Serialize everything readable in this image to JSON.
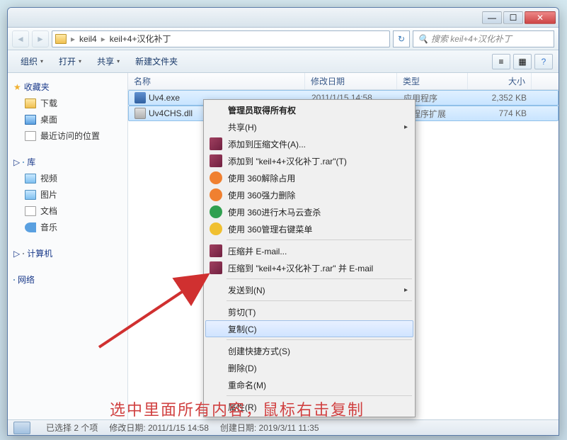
{
  "titlebar": {
    "min": "—",
    "max": "☐",
    "close": "✕"
  },
  "nav": {
    "back": "◄",
    "fwd": "►"
  },
  "breadcrumb": {
    "seg1": "keil4",
    "seg2": "keil+4+汉化补丁",
    "sep": "▸"
  },
  "refresh": "↻",
  "search": {
    "placeholder": "搜索 keil+4+汉化补丁",
    "icon": "🔍"
  },
  "toolbar": {
    "org": "组织",
    "open": "打开",
    "share": "共享",
    "new": "新建文件夹",
    "dd": "▾",
    "view1": "≡",
    "view2": "▦",
    "help": "?"
  },
  "columns": {
    "name": "名称",
    "date": "修改日期",
    "type": "类型",
    "size": "大小"
  },
  "sidebar": {
    "fav": {
      "hdr": "收藏夹",
      "star": "★",
      "items": [
        "下载",
        "桌面",
        "最近访问的位置"
      ]
    },
    "lib": {
      "hdr": "库",
      "items": [
        "视频",
        "图片",
        "文档",
        "音乐"
      ]
    },
    "pc": {
      "hdr": "计算机"
    },
    "net": {
      "hdr": "网络"
    },
    "exp": "▷"
  },
  "files": [
    {
      "name": "Uv4.exe",
      "date": "2011/1/15 14:58",
      "type": "应用程序",
      "size": "2,352 KB"
    },
    {
      "name": "Uv4CHS.dll",
      "date": "",
      "type": "用程序扩展",
      "size": "774 KB"
    }
  ],
  "ctx": {
    "admin": "管理员取得所有权",
    "share": "共享(H)",
    "addarc": "添加到压缩文件(A)...",
    "addrar": "添加到 \"keil+4+汉化补丁.rar\"(T)",
    "unlock": "使用 360解除占用",
    "forcedel": "使用 360强力删除",
    "cloudscan": "使用 360进行木马云查杀",
    "rmenu": "使用 360管理右键菜单",
    "ziemail": "压缩并 E-mail...",
    "zipemail2": "压缩到 \"keil+4+汉化补丁.rar\" 并 E-mail",
    "sendto": "发送到(N)",
    "cut": "剪切(T)",
    "copy": "复制(C)",
    "shortcut": "创建快捷方式(S)",
    "delete": "删除(D)",
    "rename": "重命名(M)",
    "props": "属性(R)",
    "arrow": "▸"
  },
  "status": {
    "sel": "已选择 2 个项",
    "mod": "修改日期: 2011/1/15 14:58",
    "created": "创建日期: 2019/3/11 11:35"
  },
  "caption": "选中里面所有内容，鼠标右击复制"
}
